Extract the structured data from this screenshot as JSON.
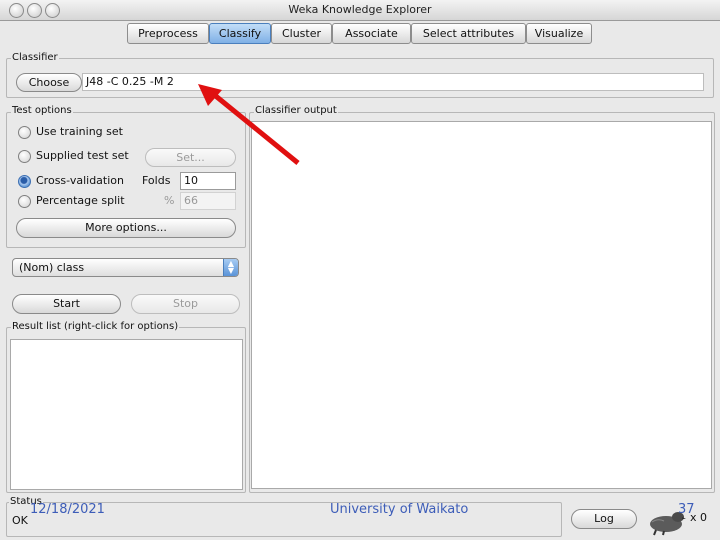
{
  "window": {
    "title": "Weka Knowledge Explorer"
  },
  "tabs": [
    {
      "label": "Preprocess",
      "selected": false
    },
    {
      "label": "Classify",
      "selected": true
    },
    {
      "label": "Cluster",
      "selected": false
    },
    {
      "label": "Associate",
      "selected": false
    },
    {
      "label": "Select attributes",
      "selected": false
    },
    {
      "label": "Visualize",
      "selected": false
    }
  ],
  "classifier": {
    "group_label": "Classifier",
    "choose_label": "Choose",
    "value": "J48 -C 0.25 -M 2"
  },
  "test_options": {
    "group_label": "Test options",
    "options": [
      {
        "label": "Use training set",
        "selected": false
      },
      {
        "label": "Supplied test set",
        "selected": false
      },
      {
        "label": "Cross-validation",
        "selected": true
      },
      {
        "label": "Percentage split",
        "selected": false
      }
    ],
    "set_label": "Set...",
    "folds_label": "Folds",
    "folds_value": "10",
    "percent_symbol": "%",
    "percent_value": "66",
    "more_options_label": "More options..."
  },
  "class_select": {
    "value": "(Nom) class"
  },
  "run": {
    "start_label": "Start",
    "stop_label": "Stop"
  },
  "result_list": {
    "group_label": "Result list (right-click for options)"
  },
  "classifier_output": {
    "group_label": "Classifier output"
  },
  "status": {
    "group_label": "Status",
    "text": "OK",
    "log_label": "Log",
    "count": "x 0"
  },
  "footer": {
    "date": "12/18/2021",
    "institution": "University of Waikato",
    "page": "37"
  },
  "colors": {
    "accent": "#7fb0e6",
    "annotation_arrow": "#e01010",
    "footer_text": "#3d5db8"
  }
}
